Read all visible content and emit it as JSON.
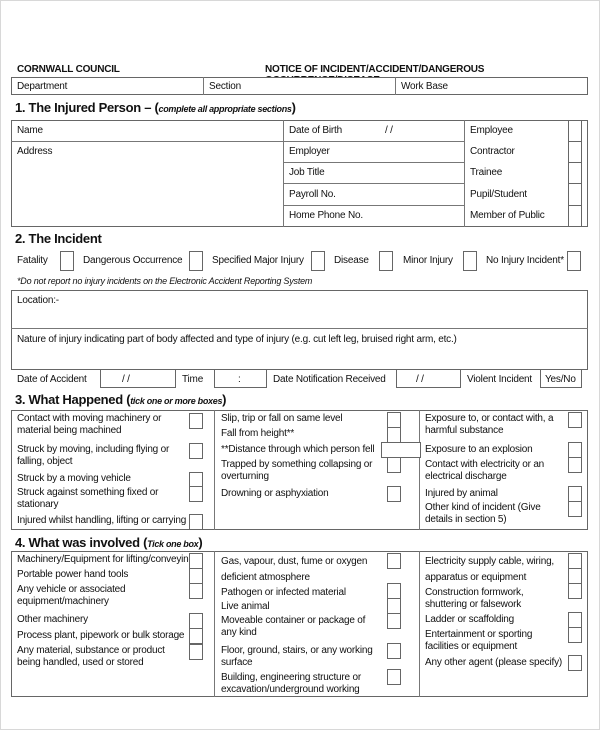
{
  "header": {
    "org": "CORNWALL COUNCIL",
    "title": "NOTICE OF INCIDENT/ACCIDENT/DANGEROUS OCCURRENCE/DISEASE",
    "fields": [
      "Department",
      "Section",
      "Work Base"
    ]
  },
  "section1": {
    "title": "1. The Injured Person – (",
    "subtitle": "complete all appropriate sections",
    "close": ")",
    "name_label": "Name",
    "address_label": "Address",
    "middle_fields": [
      "Date of Birth",
      "Employer",
      "Job Title",
      "Payroll No.",
      "Home Phone No."
    ],
    "dob_slashes": "/        /",
    "categories": [
      "Employee",
      "Contractor",
      "Trainee",
      "Pupil/Student",
      "Member of Public"
    ]
  },
  "section2": {
    "title": "2. The Incident",
    "types": [
      "Fatality",
      "Dangerous Occurrence",
      "Specified Major Injury",
      "Disease",
      "Minor Injury",
      "No Injury Incident*"
    ],
    "footnote": "*Do not report no injury incidents on the Electronic Accident Reporting System",
    "location_label": "Location:-",
    "nature_label": "Nature of injury indicating part of body affected and type of injury (e.g. cut left leg, bruised right arm, etc.)",
    "date_accident_label": "Date of Accident",
    "date_slashes": "/        /",
    "time_label": "Time",
    "time_colon": ":",
    "date_notification_label": "Date Notification Received",
    "violent_label": "Violent Incident",
    "violent_value": "Yes/No"
  },
  "section3": {
    "title": "3. What Happened (",
    "subtitle": "tick one or more boxes",
    "close": ")",
    "col1": [
      "Contact with moving machinery or material being machined",
      "Struck by moving, including flying or falling, object",
      "Struck by a moving vehicle",
      "Struck against something fixed or stationary",
      "Injured whilst handling, lifting or carrying"
    ],
    "col2": [
      "Slip, trip or fall on same level",
      "Fall from height**",
      "**Distance through which person fell",
      "Trapped by something collapsing or overturning",
      "Drowning or asphyxiation"
    ],
    "col3": [
      "Exposure to, or contact with, a harmful substance",
      "Exposure to an explosion",
      "Contact with electricity or an electrical discharge",
      "Injured by animal",
      "Other kind of incident (Give details in section 5)"
    ]
  },
  "section4": {
    "title": "4. What was involved (",
    "subtitle": "Tick one box",
    "close": ")",
    "col1": [
      "Machinery/Equipment for lifting/conveying",
      "Portable power hand tools",
      "Any vehicle or associated equipment/machinery",
      "Other machinery",
      "Process plant, pipework or bulk storage",
      "Any material, substance or product being handled, used or stored"
    ],
    "col2": [
      "Gas, vapour, dust, fume or oxygen deficient atmosphere",
      "Pathogen or infected material",
      "Live animal",
      "Moveable container or package of any kind",
      "Floor, ground, stairs, or any working surface",
      "Building, engineering structure or excavation/underground working"
    ],
    "col3": [
      "Electricity supply cable, wiring, apparatus or equipment",
      "Construction formwork, shuttering or falsework",
      "Ladder or scaffolding",
      "Entertainment or sporting facilities or equipment",
      "Any other agent (please specify)"
    ]
  }
}
